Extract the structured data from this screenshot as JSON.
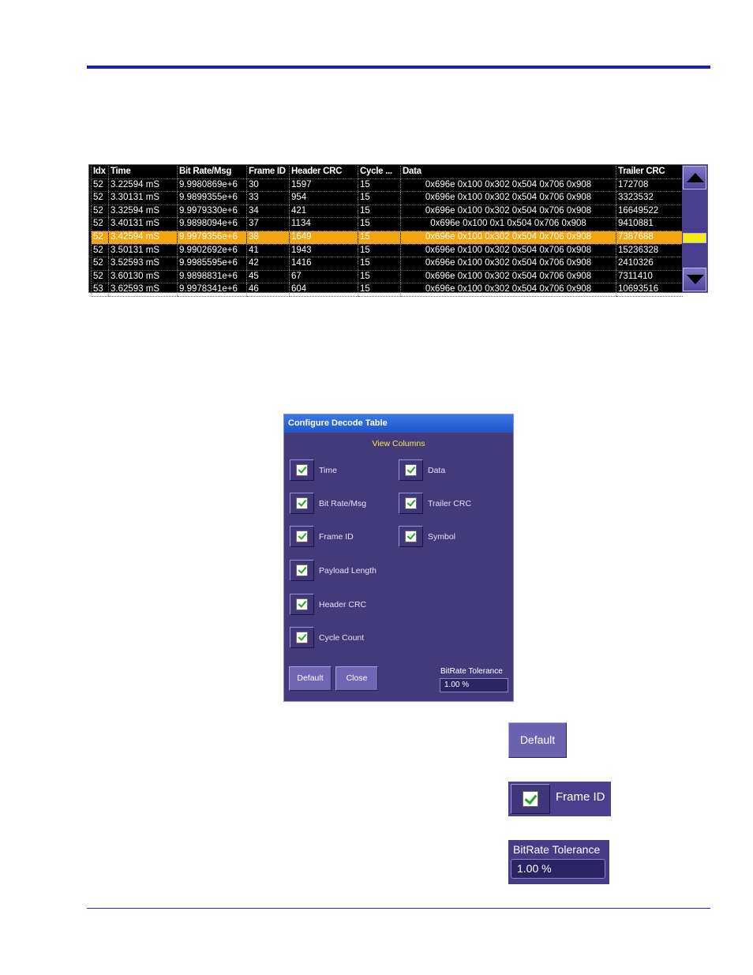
{
  "decode_table": {
    "columns": [
      "Idx",
      "Time",
      "Bit Rate/Msg",
      "Frame ID",
      "Header CRC",
      "Cycle ...",
      "Data",
      "Trailer CRC"
    ],
    "rows": [
      [
        "52",
        "3.22594 mS",
        "9.9980869e+6",
        "30",
        "1597",
        "15",
        "0x696e 0x100 0x302 0x504 0x706 0x908",
        "172708"
      ],
      [
        "52",
        "3.30131 mS",
        "9.9899355e+6",
        "33",
        "954",
        "15",
        "0x696e 0x100 0x302 0x504 0x706 0x908",
        "3323532"
      ],
      [
        "52",
        "3.32594 mS",
        "9.9979330e+6",
        "34",
        "421",
        "15",
        "0x696e 0x100 0x302 0x504 0x706 0x908",
        "16649522"
      ],
      [
        "52",
        "3.40131 mS",
        "9.9898094e+6",
        "37",
        "1134",
        "15",
        "0x696e 0x100 0x1 0x504 0x706 0x908",
        "9410881"
      ],
      [
        "52",
        "3.42594 mS",
        "9.9979356e+6",
        "38",
        "1649",
        "15",
        "0x696e 0x100 0x302 0x504 0x706 0x908",
        "7387688"
      ],
      [
        "52",
        "3.50131 mS",
        "9.9902692e+6",
        "41",
        "1943",
        "15",
        "0x696e 0x100 0x302 0x504 0x706 0x908",
        "15236328"
      ],
      [
        "52",
        "3.52593 mS",
        "9.9985595e+6",
        "42",
        "1416",
        "15",
        "0x696e 0x100 0x302 0x504 0x706 0x908",
        "2410326"
      ],
      [
        "52",
        "3.60130 mS",
        "9.9898831e+6",
        "45",
        "67",
        "15",
        "0x696e 0x100 0x302 0x504 0x706 0x908",
        "7311410"
      ],
      [
        "53",
        "3.62593 mS",
        "9.9978341e+6",
        "46",
        "604",
        "15",
        "0x696e 0x100 0x302 0x504 0x706 0x908",
        "10693516"
      ]
    ],
    "selected_row": 4,
    "selected_color": "#f2a413"
  },
  "dialog": {
    "title": "Configure Decode Table",
    "section_heading": "View Columns",
    "checkboxes": {
      "time": {
        "label": "Time",
        "checked": true
      },
      "data": {
        "label": "Data",
        "checked": true
      },
      "bitrate": {
        "label": "Bit Rate/Msg",
        "checked": true
      },
      "trailer_crc": {
        "label": "Trailer CRC",
        "checked": true
      },
      "frame_id": {
        "label": "Frame ID",
        "checked": true
      },
      "symbol": {
        "label": "Symbol",
        "checked": true
      },
      "payload_length": {
        "label": "Payload Length",
        "checked": true
      },
      "header_crc": {
        "label": "Header CRC",
        "checked": true
      },
      "cycle_count": {
        "label": "Cycle Count",
        "checked": true
      }
    },
    "default_label": "Default",
    "close_label": "Close",
    "tolerance_label": "BitRate Tolerance",
    "tolerance_value": "1.00 %"
  },
  "callouts": {
    "default_label": "Default",
    "frame_id_label": "Frame ID",
    "tolerance_label": "BitRate Tolerance",
    "tolerance_value": "1.00 %"
  },
  "colors": {
    "rule": "#1a1acc",
    "dialog_bg": "#433a7c",
    "titlebar": "#2a62d8",
    "heading": "#f6e84a",
    "scroll_thumb": "#f6ef0a"
  }
}
